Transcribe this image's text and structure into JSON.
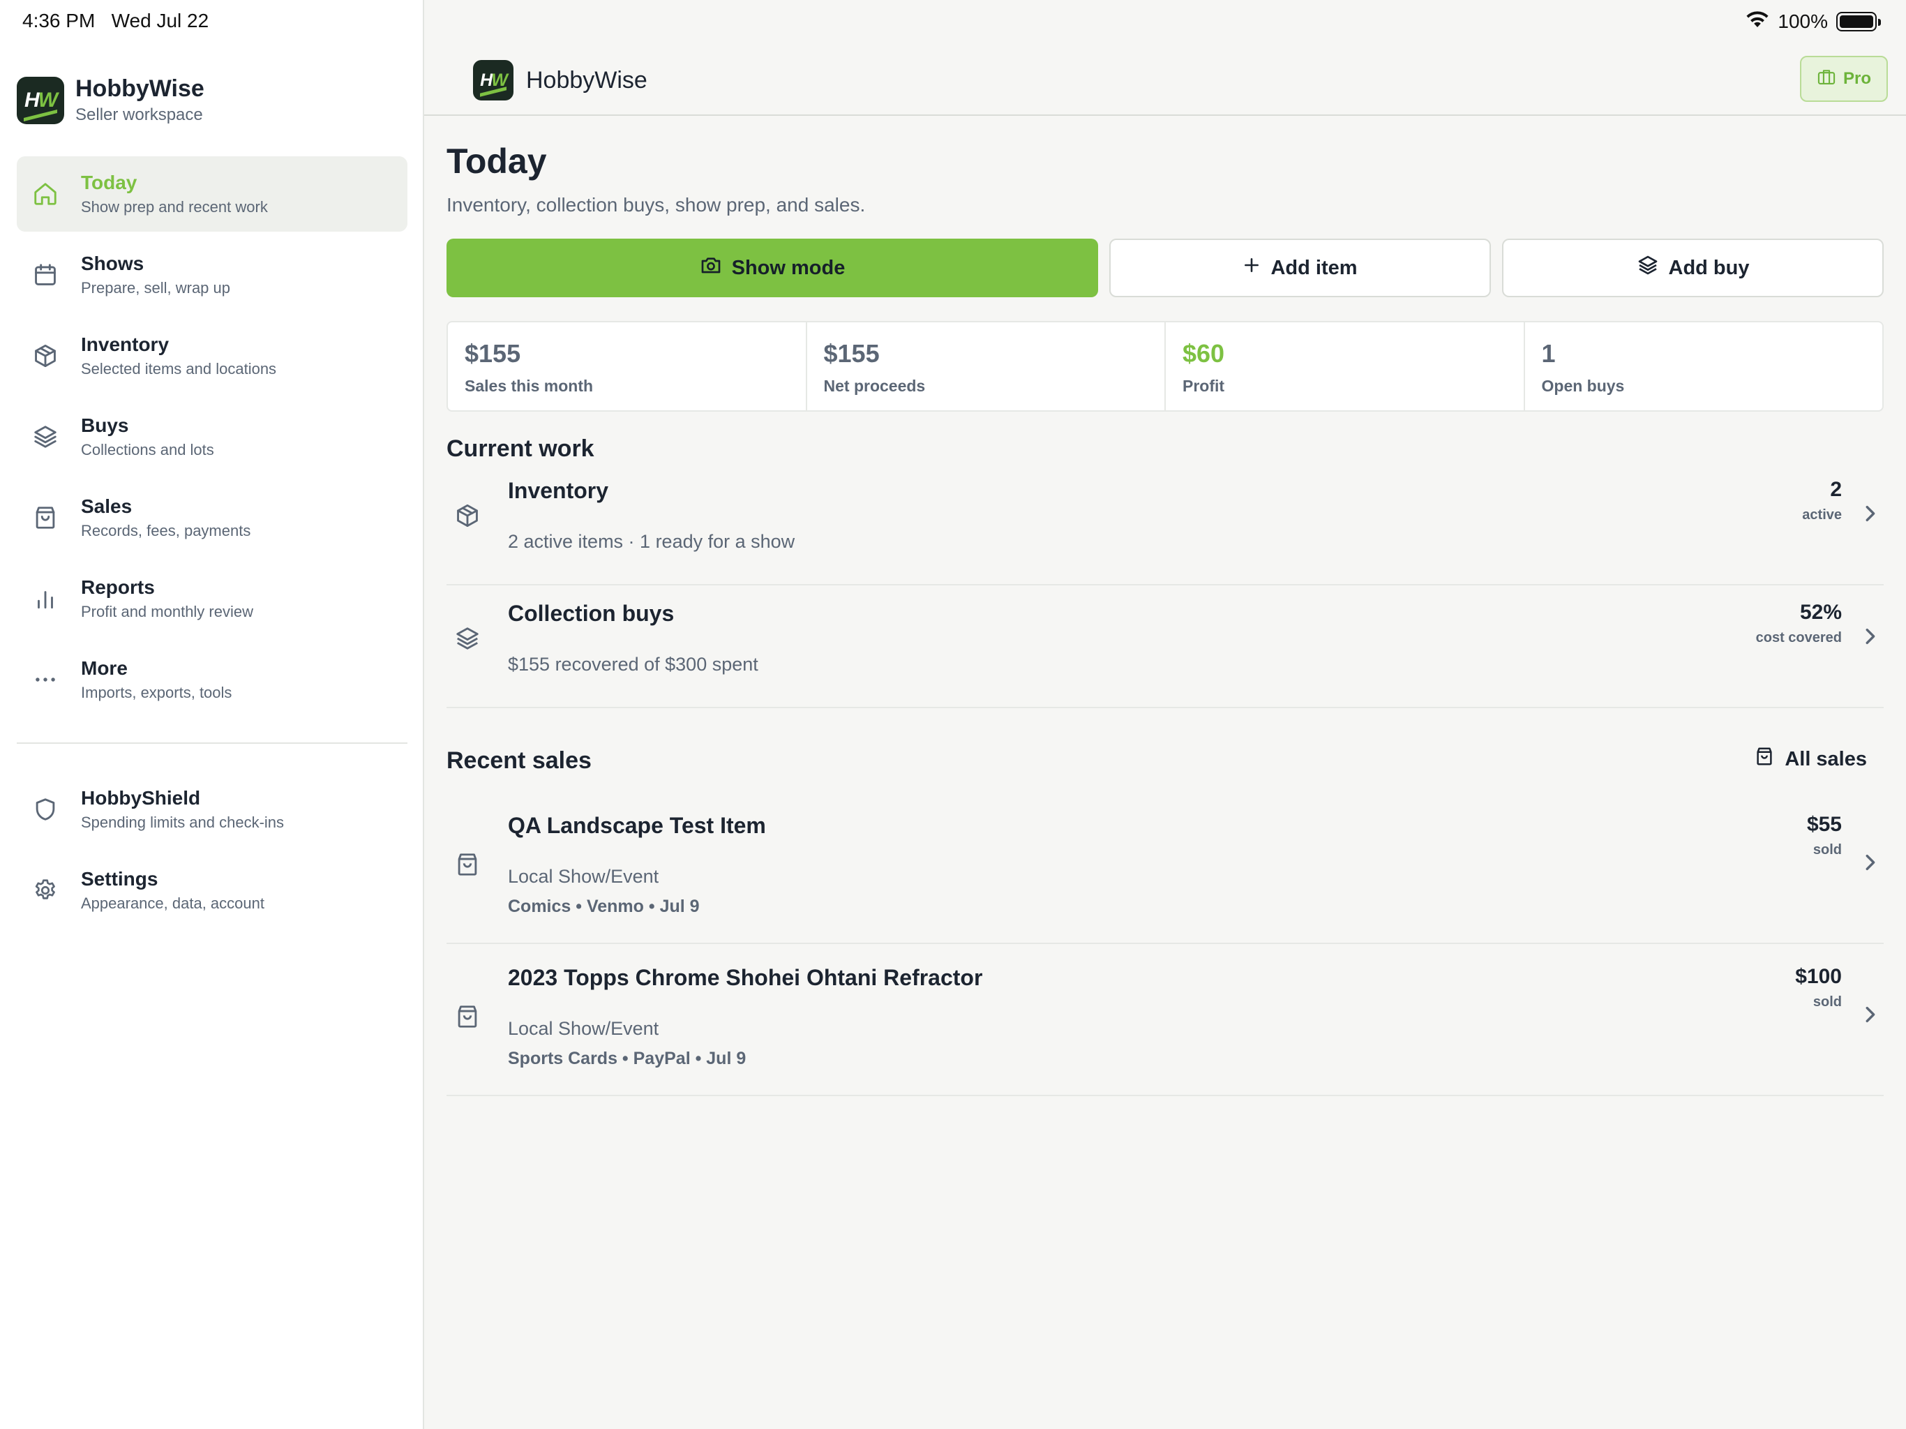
{
  "status_bar": {
    "time": "4:36 PM",
    "date": "Wed Jul 22",
    "battery": "100%"
  },
  "sidebar": {
    "brand_title": "HobbyWise",
    "brand_subtitle": "Seller workspace",
    "logo_text_h": "H",
    "logo_text_w": "W",
    "items": [
      {
        "label": "Today",
        "sub": "Show prep and recent work",
        "icon": "home-icon",
        "active": true
      },
      {
        "label": "Shows",
        "sub": "Prepare, sell, wrap up",
        "icon": "calendar-icon"
      },
      {
        "label": "Inventory",
        "sub": "Selected items and locations",
        "icon": "box-icon"
      },
      {
        "label": "Buys",
        "sub": "Collections and lots",
        "icon": "layers-icon"
      },
      {
        "label": "Sales",
        "sub": "Records, fees, payments",
        "icon": "bag-icon"
      },
      {
        "label": "Reports",
        "sub": "Profit and monthly review",
        "icon": "bar-chart-icon"
      },
      {
        "label": "More",
        "sub": "Imports, exports, tools",
        "icon": "more-icon"
      }
    ],
    "secondary_items": [
      {
        "label": "HobbyShield",
        "sub": "Spending limits and check-ins",
        "icon": "shield-icon"
      },
      {
        "label": "Settings",
        "sub": "Appearance, data, account",
        "icon": "gear-icon"
      }
    ]
  },
  "topbar": {
    "title": "HobbyWise",
    "pro_label": "Pro"
  },
  "page": {
    "title": "Today",
    "subtitle": "Inventory, collection buys, show prep, and sales."
  },
  "actions": {
    "show_mode": "Show mode",
    "add_item": "Add item",
    "add_buy": "Add buy"
  },
  "stats": [
    {
      "value": "$155",
      "label": "Sales this month"
    },
    {
      "value": "$155",
      "label": "Net proceeds"
    },
    {
      "value": "$60",
      "label": "Profit",
      "color": "#7dc142"
    },
    {
      "value": "1",
      "label": "Open buys"
    }
  ],
  "current_work": {
    "title": "Current work",
    "rows": [
      {
        "title": "Inventory",
        "sub": "2 active items · 1 ready for a show",
        "value": "2",
        "caption": "active",
        "icon": "box-icon"
      },
      {
        "title": "Collection buys",
        "sub": "$155 recovered of $300 spent",
        "value": "52%",
        "caption": "cost covered",
        "icon": "layers-icon"
      }
    ]
  },
  "recent_sales": {
    "title": "Recent sales",
    "all_sales_label": "All sales",
    "rows": [
      {
        "title": "QA Landscape Test Item",
        "channel": "Local Show/Event",
        "meta": "Comics • Venmo • Jul 9",
        "value": "$55",
        "caption": "sold",
        "icon": "bag-icon"
      },
      {
        "title": "2023 Topps Chrome Shohei Ohtani Refractor",
        "channel": "Local Show/Event",
        "meta": "Sports Cards • PayPal • Jul 9",
        "value": "$100",
        "caption": "sold",
        "icon": "bag-icon"
      }
    ]
  },
  "colors": {
    "accent": "#7dc142",
    "text": "#1c2430",
    "muted": "#5b6675",
    "background": "#f6f6f4"
  }
}
